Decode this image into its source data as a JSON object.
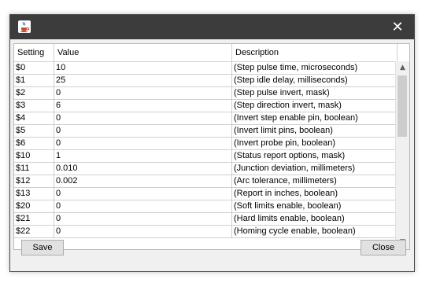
{
  "window": {
    "close_glyph": "✕",
    "icon": "java-cup-icon"
  },
  "table": {
    "columns": [
      "Setting",
      "Value",
      "Description"
    ],
    "rows": [
      [
        "$0",
        "10",
        "(Step pulse time, microseconds)"
      ],
      [
        "$1",
        "25",
        "(Step idle delay, milliseconds)"
      ],
      [
        "$2",
        "0",
        "(Step pulse invert, mask)"
      ],
      [
        "$3",
        "6",
        "(Step direction invert, mask)"
      ],
      [
        "$4",
        "0",
        "(Invert step enable pin, boolean)"
      ],
      [
        "$5",
        "0",
        "(Invert limit pins, boolean)"
      ],
      [
        "$6",
        "0",
        "(Invert probe pin, boolean)"
      ],
      [
        "$10",
        "1",
        "(Status report options, mask)"
      ],
      [
        "$11",
        "0.010",
        "(Junction deviation, millimeters)"
      ],
      [
        "$12",
        "0.002",
        "(Arc tolerance, millimeters)"
      ],
      [
        "$13",
        "0",
        "(Report in inches, boolean)"
      ],
      [
        "$20",
        "0",
        "(Soft limits enable, boolean)"
      ],
      [
        "$21",
        "0",
        "(Hard limits enable, boolean)"
      ],
      [
        "$22",
        "0",
        "(Homing cycle enable, boolean)"
      ]
    ],
    "scroll_up_glyph": "▲",
    "scroll_down_glyph": "▼"
  },
  "buttons": {
    "save_label": "Save",
    "close_label": "Close"
  }
}
